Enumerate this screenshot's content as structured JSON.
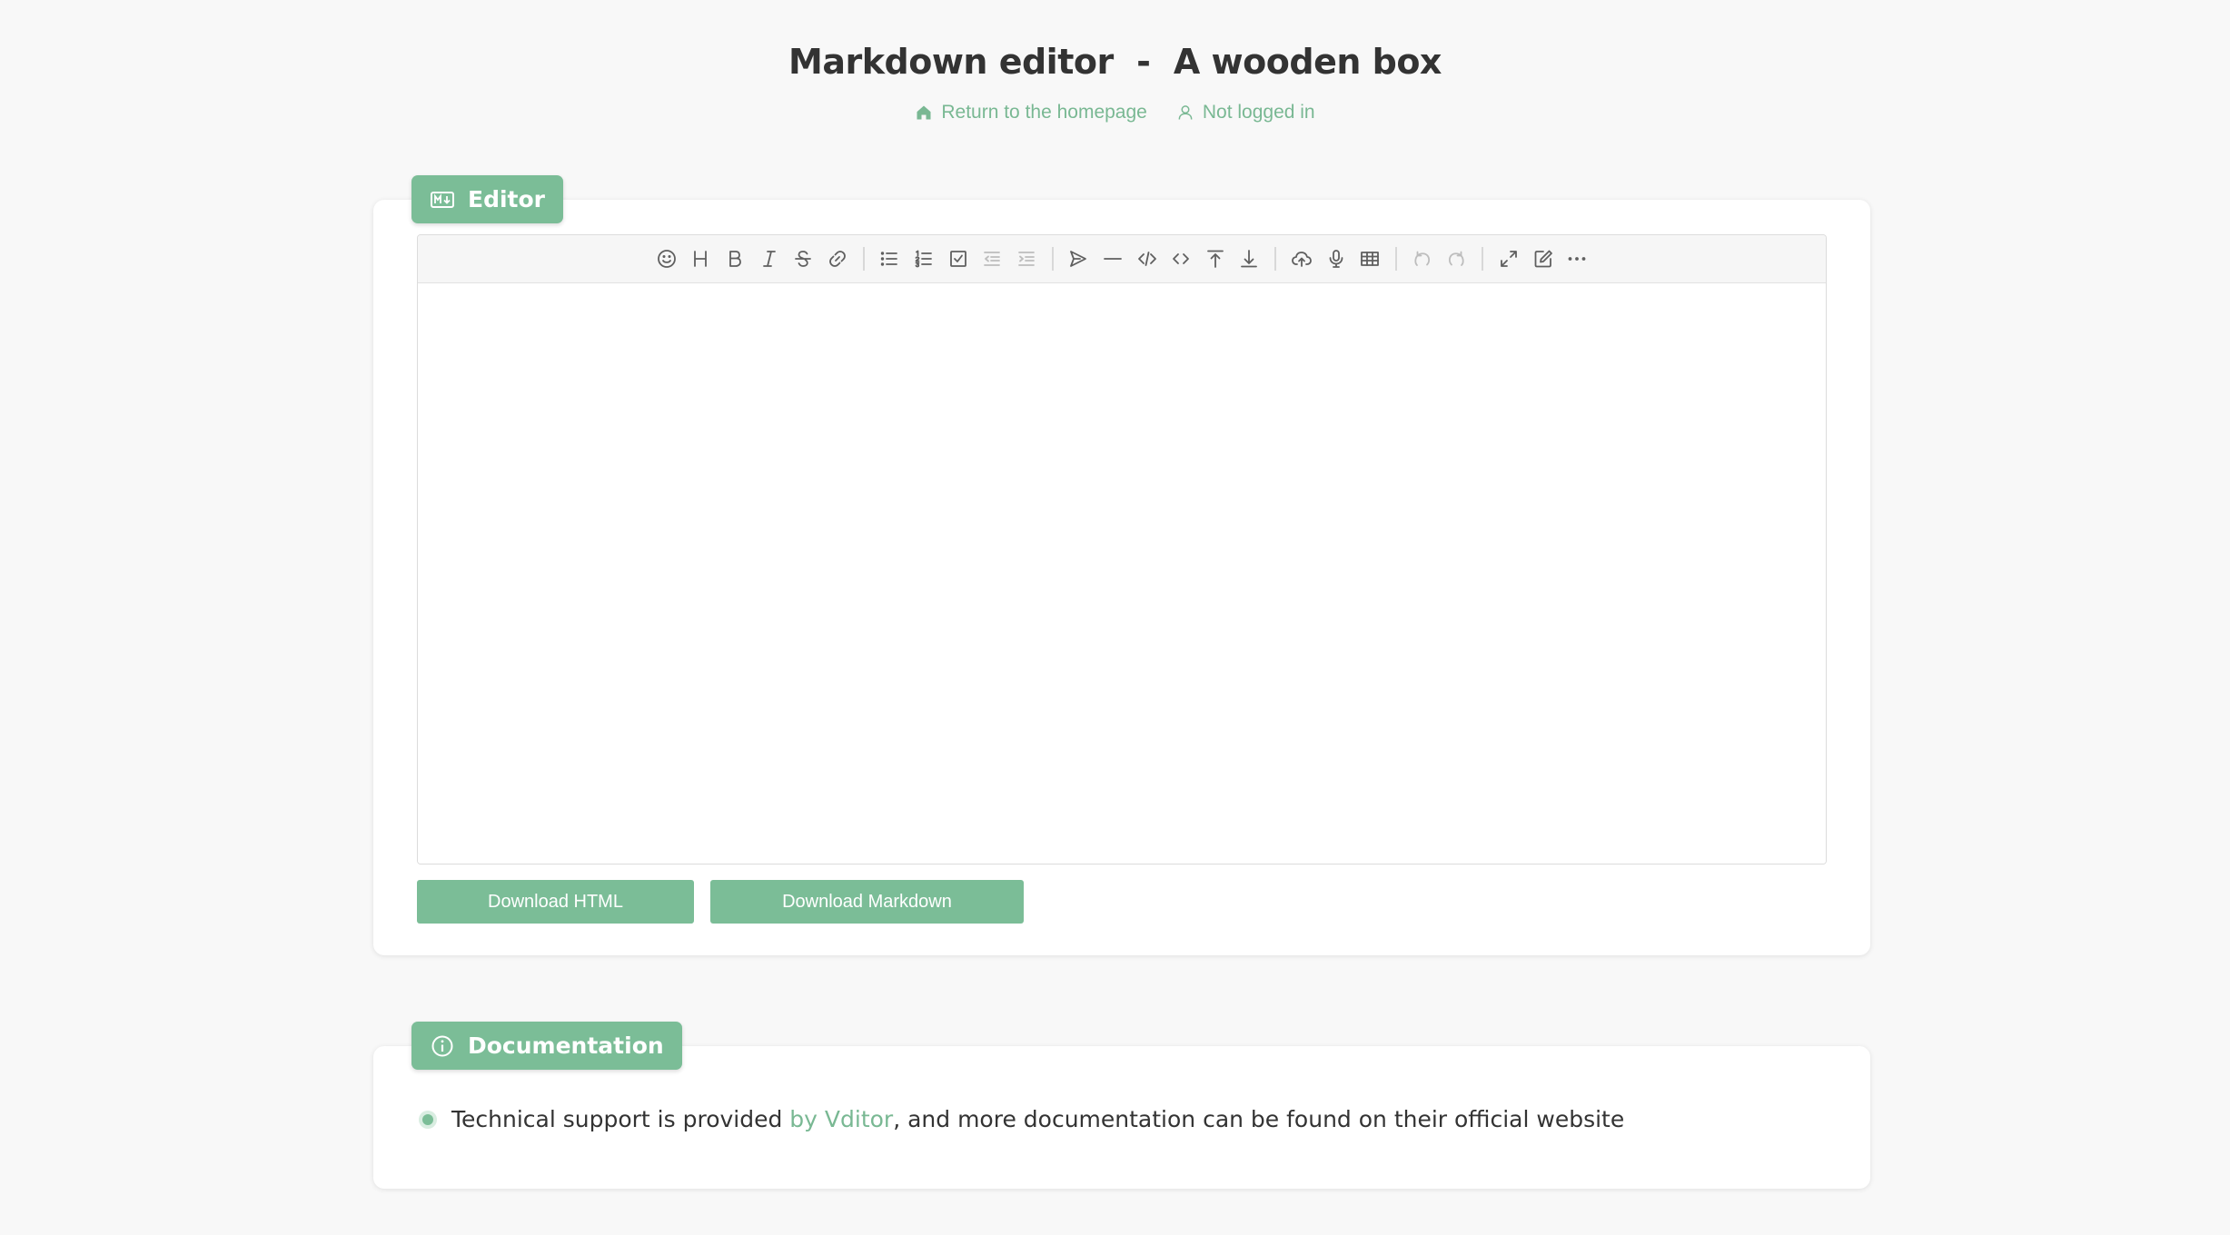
{
  "header": {
    "title": "Markdown editor  -  A wooden box",
    "home_link": "Return to the homepage",
    "login_link": "Not logged in"
  },
  "editor_card": {
    "tab_label": "Editor",
    "tab_icon": "markdown-icon",
    "content": "",
    "toolbar": [
      "emoji",
      "headings",
      "bold",
      "italic",
      "strike",
      "link",
      "|",
      "list",
      "ordered-list",
      "check",
      "outdent",
      "indent",
      "|",
      "quote",
      "line",
      "code",
      "inline-code",
      "insert-before",
      "insert-after",
      "|",
      "upload",
      "record",
      "table",
      "|",
      "undo",
      "redo",
      "|",
      "fullscreen",
      "edit-mode",
      "more"
    ],
    "download_html": "Download HTML",
    "download_markdown": "Download Markdown"
  },
  "doc_card": {
    "tab_label": "Documentation",
    "tab_icon": "info-icon",
    "text_before": "Technical support is provided ",
    "link_text": "by Vditor",
    "text_after": ", and more documentation can be found on their official website"
  },
  "colors": {
    "accent": "#7bbd97",
    "link": "#79b893",
    "background": "#f8f8f8",
    "text": "#333333"
  }
}
